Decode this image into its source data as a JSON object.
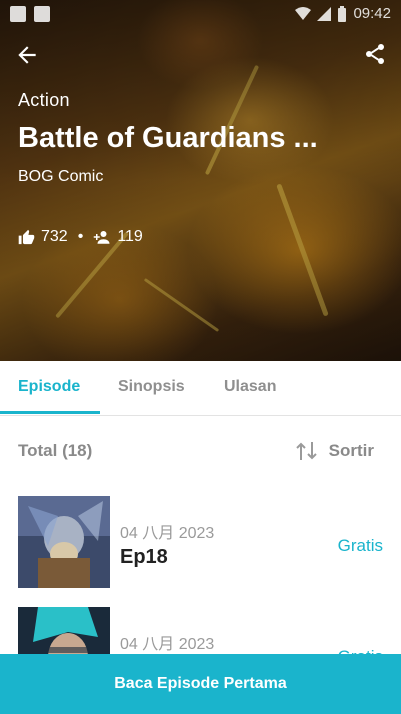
{
  "status_bar": {
    "time": "09:42"
  },
  "header": {
    "genre": "Action",
    "title": "Battle of Guardians ...",
    "author": "BOG Comic",
    "likes": "732",
    "followers": "119"
  },
  "tabs": [
    {
      "label": "Episode",
      "active": true
    },
    {
      "label": "Sinopsis",
      "active": false
    },
    {
      "label": "Ulasan",
      "active": false
    }
  ],
  "episode_list": {
    "total_label": "Total (18)",
    "sort_label": "Sortir",
    "items": [
      {
        "date": "04 八月 2023",
        "title": "Ep18",
        "price": "Gratis"
      },
      {
        "date": "04 八月 2023",
        "title": "",
        "price": "Gratis"
      }
    ]
  },
  "cta": {
    "label": "Baca Episode Pertama"
  },
  "colors": {
    "accent": "#1ab4cc",
    "muted": "#8a8a8a"
  },
  "icons": [
    "back-arrow-icon",
    "share-icon",
    "thumbs-up-icon",
    "add-person-icon",
    "sort-icon"
  ]
}
